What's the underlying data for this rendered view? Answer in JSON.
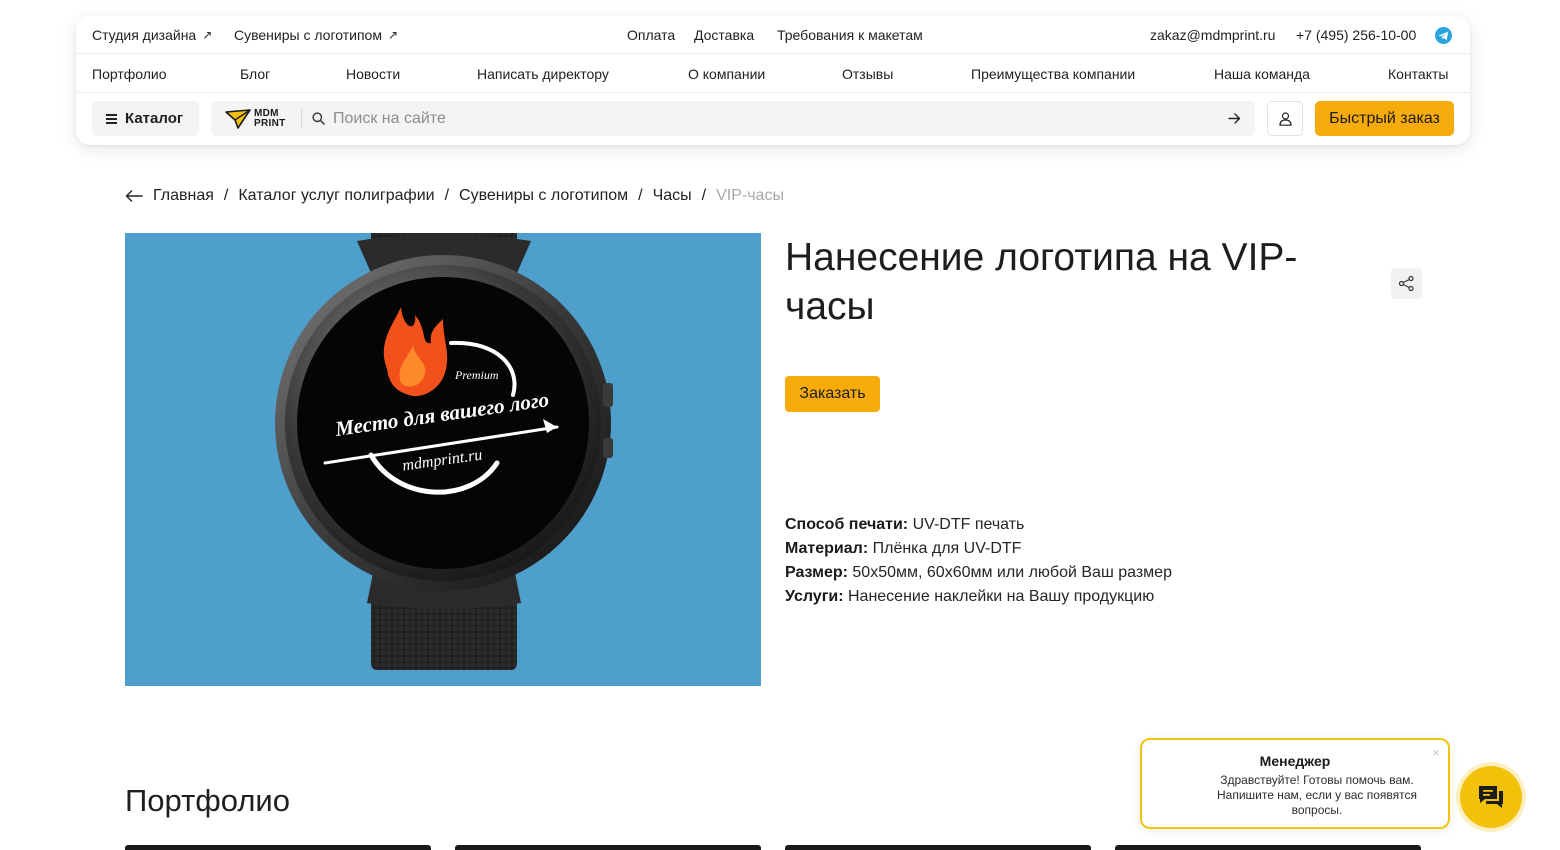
{
  "header": {
    "top_left": [
      {
        "label": "Студия дизайна",
        "arrow": "↗"
      },
      {
        "label": "Сувениры с логотипом",
        "arrow": "↗"
      }
    ],
    "top_center": [
      "Оплата",
      "Доставка",
      "Требования к макетам"
    ],
    "email": "zakaz@mdmprint.ru",
    "phone": "+7 (495) 256-10-00",
    "telegram_icon": "telegram-icon",
    "nav": [
      "Портфолио",
      "Блог",
      "Новости",
      "Написать директору",
      "О компании",
      "Отзывы",
      "Преимущества компании",
      "Наша команда",
      "Контакты"
    ],
    "catalog_label": "Каталог",
    "logo": {
      "line1": "MDM",
      "line2": "PRINT"
    },
    "search_placeholder": "Поиск на сайте",
    "quick_order_label": "Быстрый заказ"
  },
  "breadcrumb": {
    "items": [
      "Главная",
      "Каталог услуг полиграфии",
      "Сувениры с логотипом",
      "Часы"
    ],
    "current": "VIP-часы",
    "separator": "/"
  },
  "product": {
    "title": "Нанесение логотипа на VIP-часы",
    "image": {
      "background_color": "#4e9fcb",
      "badge": "Premium",
      "slogan": "Место для вашего лого",
      "site": "mdmprint.ru"
    },
    "order_label": "Заказать",
    "specs": [
      {
        "label": "Способ печати:",
        "value": "UV-DTF печать"
      },
      {
        "label": "Материал:",
        "value": "Плёнка для UV-DTF"
      },
      {
        "label": "Размер:",
        "value": "50х50мм, 60х60мм или любой Ваш размер"
      },
      {
        "label": "Услуги:",
        "value": "Нанесение наклейки на Вашу продукцию"
      }
    ]
  },
  "portfolio": {
    "heading": "Портфолио"
  },
  "chat": {
    "name": "Менеджер",
    "message": "Здравствуйте! Готовы помочь вам. Напишите нам, если у вас появятся вопросы.",
    "close": "×"
  },
  "colors": {
    "accent": "#f6ab0a",
    "chat_accent": "#f2c10a",
    "muted_text": "#a8a8a8"
  }
}
